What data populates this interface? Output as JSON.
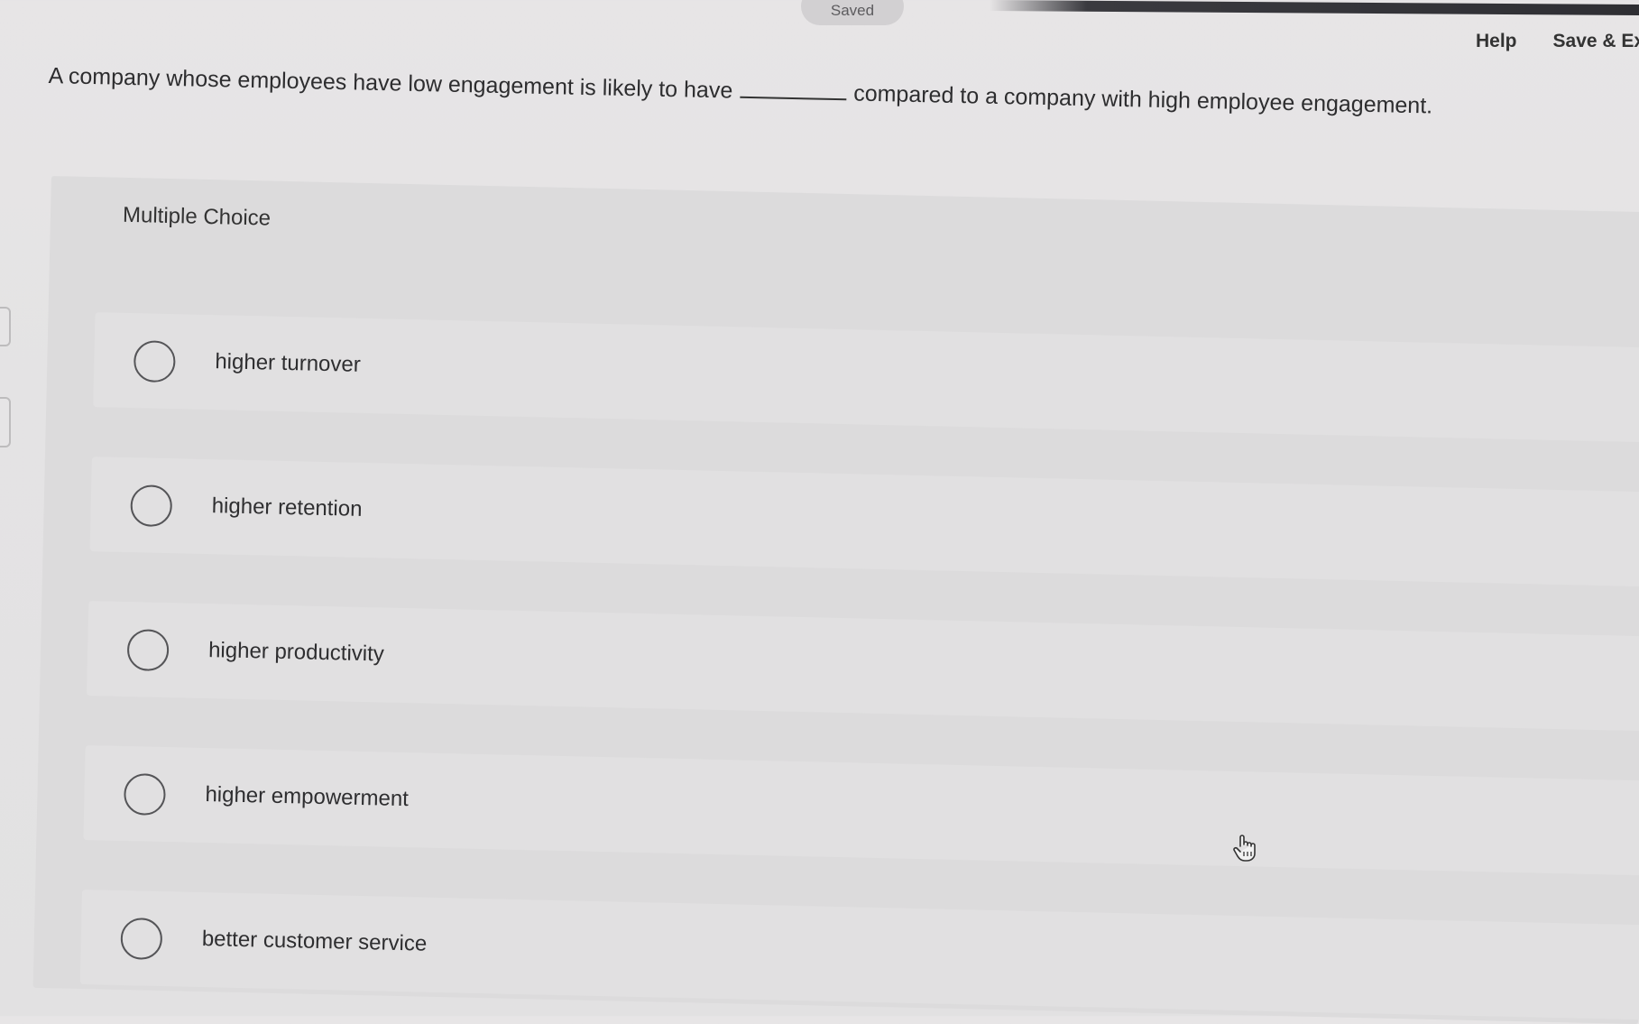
{
  "status": {
    "saved_label": "Saved"
  },
  "header": {
    "help_label": "Help",
    "save_exit_label": "Save & Exi"
  },
  "question": {
    "text_before": "A company whose employees have low engagement is likely to have",
    "text_after": "compared to a company with high employee engagement."
  },
  "multiple_choice": {
    "heading": "Multiple Choice",
    "options": [
      {
        "label": "higher turnover"
      },
      {
        "label": "higher retention"
      },
      {
        "label": "higher productivity"
      },
      {
        "label": "higher empowerment"
      },
      {
        "label": "better customer service"
      }
    ]
  },
  "icons": {
    "cursor": "hand-pointer-icon",
    "radio": "radio-circle-icon"
  },
  "colors": {
    "background": "#e5e4e5",
    "panel": "#dcdbdc",
    "option_bg": "#e1e0e1",
    "text": "#2d2d2f"
  }
}
